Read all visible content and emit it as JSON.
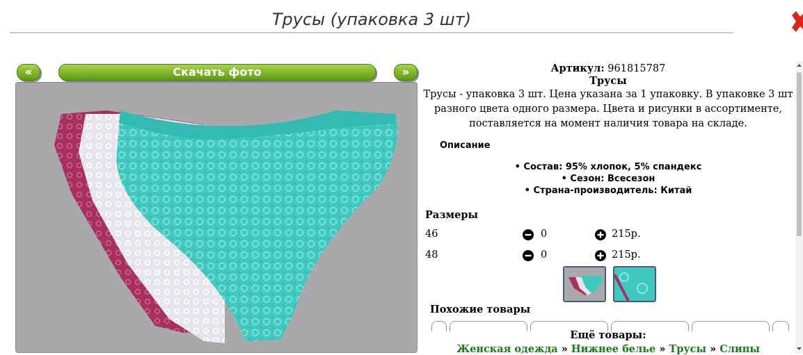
{
  "header": {
    "title": "Трусы (упаковка 3 шт)"
  },
  "gallery": {
    "prev_label": "«",
    "next_label": "»",
    "download_label": "Скачать фото"
  },
  "product": {
    "article_label": "Артикул:",
    "article_value": "961815787",
    "name": "Трусы",
    "description": "Трусы - упаковка 3 шт. Цена указана за 1 упаковку. В упаковке 3 шт разного цвета одного размера. Цвета и рисунки в ассортименте, поставляется на момент наличия товара на складе.",
    "opisanie_label": "Описание",
    "properties": [
      "Состав: 95% хлопок, 5% спандекс",
      "Сезон: Всесезон",
      "Страна-производитель: Китай"
    ]
  },
  "sizes": {
    "heading": "Размеры",
    "rows": [
      {
        "size": "46",
        "qty": "0",
        "price": "215р."
      },
      {
        "size": "48",
        "qty": "0",
        "price": "215р."
      }
    ]
  },
  "similar": {
    "heading": "Похожие товары"
  },
  "more": {
    "heading": "Ещё товары:",
    "crumbs": [
      "Женская одежда",
      "Нижнее белье",
      "Трусы",
      "Слипы"
    ],
    "separator": "»"
  },
  "colors": {
    "button_green": "#6aa61c",
    "link_green": "#1a7a1a",
    "close_red": "#d9251c"
  }
}
